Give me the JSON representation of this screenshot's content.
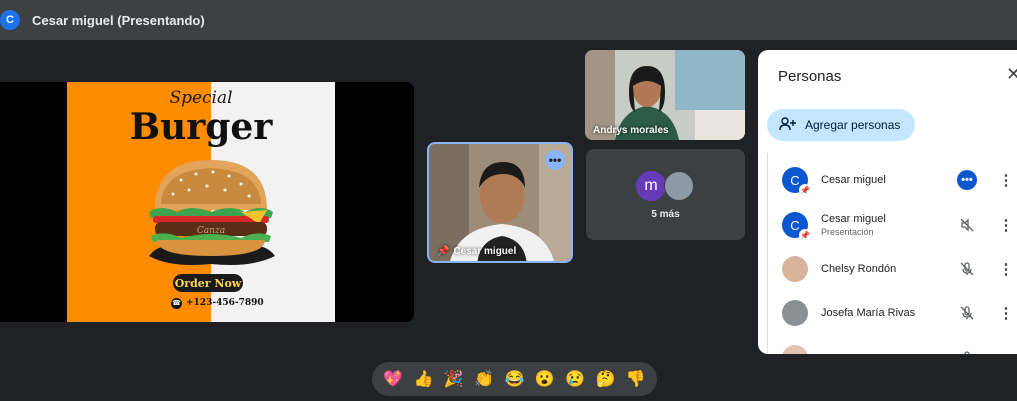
{
  "header": {
    "avatar_letter": "C",
    "title": "Cesar miguel (Presentando)"
  },
  "slide": {
    "script_title": "Special",
    "main_title": "Burger",
    "patty_word": "Canza",
    "button_label": "Order Now",
    "phone": "+123-456-7890"
  },
  "tiles": {
    "cesar": {
      "name": "Cesar miguel"
    },
    "andrys": {
      "name": "Andrys morales"
    },
    "more": {
      "avatar_letter": "m",
      "label": "5 más"
    }
  },
  "panel": {
    "title": "Personas",
    "add_label": "Agregar personas",
    "people": [
      {
        "name": "Cesar miguel",
        "sub": "",
        "avatar": "C",
        "status": "more-options"
      },
      {
        "name": "Cesar miguel",
        "sub": "Presentación",
        "avatar": "C",
        "status": "audio-off"
      },
      {
        "name": "Chelsy Rondón",
        "sub": "",
        "avatar": "",
        "status": "mic-off"
      },
      {
        "name": "Josefa María Rivas",
        "sub": "",
        "avatar": "",
        "status": "mic-off"
      }
    ]
  },
  "reactions": [
    "💖",
    "👍",
    "🎉",
    "👏",
    "😂",
    "😮",
    "😢",
    "🤔",
    "👎"
  ],
  "colors": {
    "accent": "#8ab4f8",
    "panel_button": "#c2e7ff",
    "brand_blue": "#0b57d0",
    "orange": "#ff8c00"
  }
}
